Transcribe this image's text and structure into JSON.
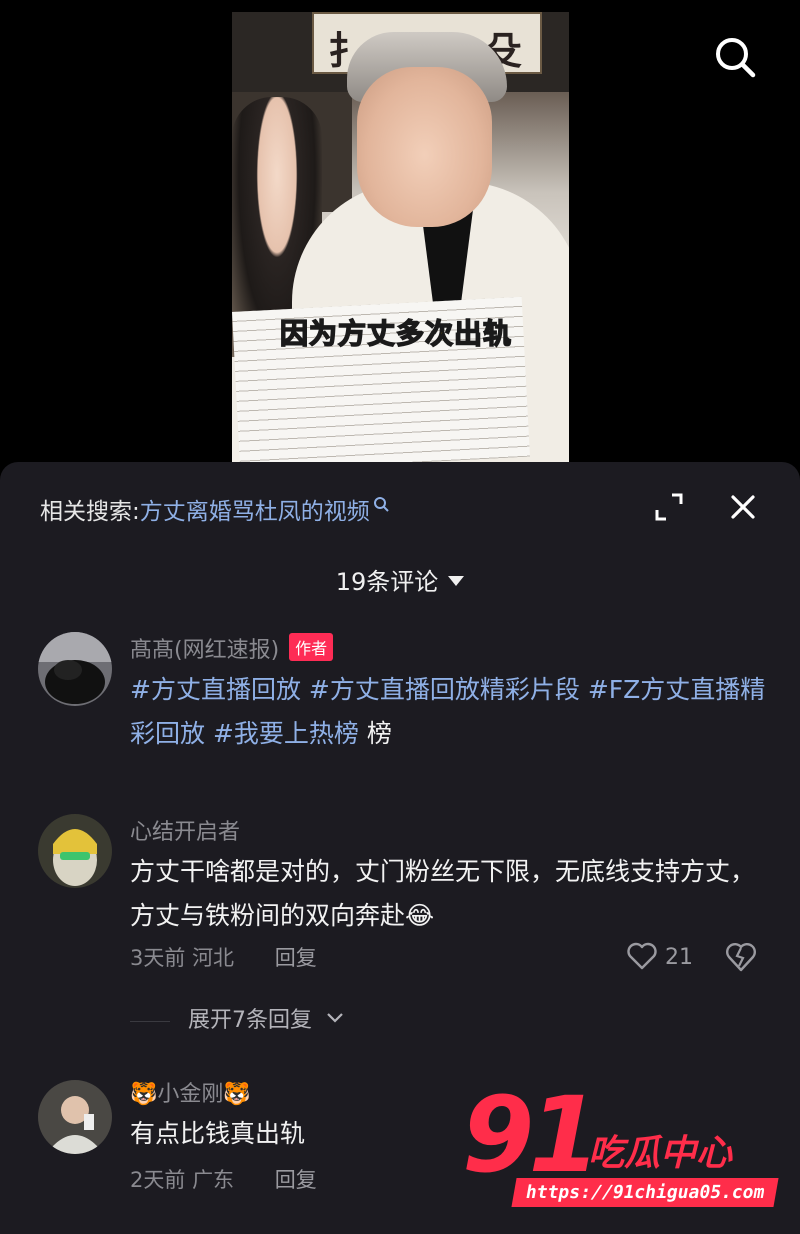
{
  "video": {
    "caption": "因为方丈多次出轨",
    "calligraphy": "…"
  },
  "related_search": {
    "label": "相关搜索:",
    "query": "方丈离婚骂杜凤的视频"
  },
  "comments_header": {
    "count_text": "19条评论"
  },
  "comments": [
    {
      "name": "髙髙(网红速报)",
      "author_tag": "作者",
      "hashtags": [
        "#方丈直播回放",
        "#方丈直播回放精彩片段",
        "#FZ方丈直播精彩回放",
        "#我要上热榜"
      ],
      "tail": "榜"
    },
    {
      "name": "心结开启者",
      "text": "方丈干啥都是对的，丈门粉丝无下限，无底线支持方丈，方丈与铁粉间的双向奔赴😂",
      "time": "3天前",
      "location": "河北",
      "reply_label": "回复",
      "likes": "21",
      "expand_label": "展开7条回复"
    },
    {
      "name": "🐯小金刚🐯",
      "text": "有点比钱真出轨",
      "time": "2天前",
      "location": "广东",
      "reply_label": "回复"
    }
  ],
  "watermark": {
    "number": "91",
    "brand": "吃瓜中心",
    "url": "https://91chigua05.com"
  },
  "colors": {
    "panel_bg": "#1c1b21",
    "link": "#8fb0e6",
    "author_tag": "#fe2c55",
    "caption": "#ffd400",
    "watermark": "#ff2d4a"
  },
  "icons": [
    "search-icon",
    "expand-icon",
    "close-icon",
    "caret-down-icon",
    "heart-icon",
    "broken-heart-icon",
    "chevron-down-icon",
    "magnifier-small-icon"
  ]
}
